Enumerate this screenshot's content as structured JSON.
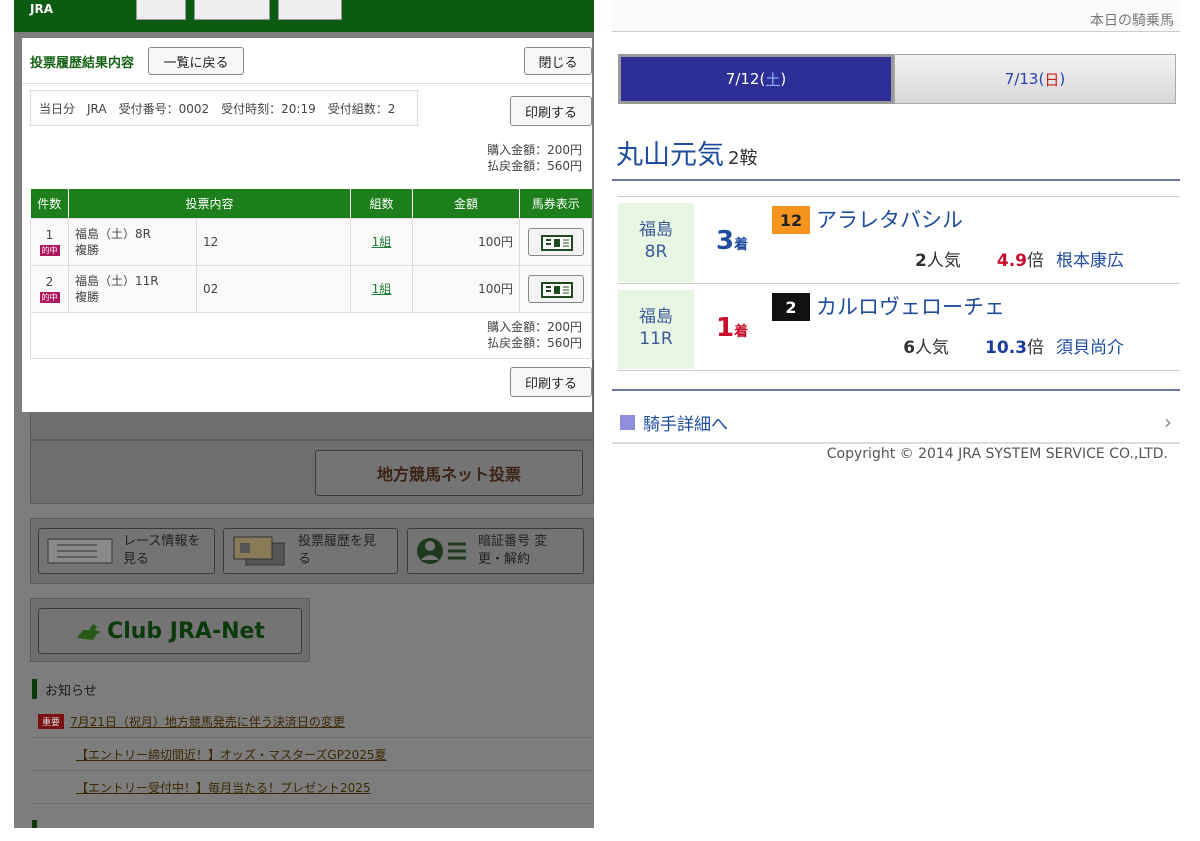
{
  "left": {
    "logo": "JRA",
    "net_button": "地方競馬ネット投票",
    "menu": [
      {
        "label": "レース情報を見る"
      },
      {
        "label": "投票履歴を見る"
      },
      {
        "label": "暗証番号 変更・解約"
      }
    ],
    "club": "Club JRA-Net",
    "notice_heading": "お知らせ",
    "notices": [
      {
        "badge": "重要",
        "text": "7月21日（祝月）地方競馬発売に伴う決済日の変更"
      },
      {
        "badge": "",
        "text": "【エントリー締切間近！】オッズ・マスターズGP2025夏"
      },
      {
        "badge": "",
        "text": "【エントリー受付中！】毎月当たる！プレゼント2025"
      }
    ],
    "modal": {
      "title": "投票履歴結果内容",
      "back_label": "一覧に戻る",
      "close_label": "閉じる",
      "info": "当日分　JRA　受付番号：0002　受付時刻：20:19　受付組数：2",
      "print_label": "印刷する",
      "purchase": "購入金額：200円",
      "refund": "払戻金額：560円",
      "headers": [
        "件数",
        "投票内容",
        "組数",
        "金額",
        "馬券表示"
      ],
      "rows": [
        {
          "num": "1",
          "hit": "的中",
          "race": "福島（土）8R",
          "type": "複勝",
          "content": "12",
          "kumi": "1組",
          "amount": "100円"
        },
        {
          "num": "2",
          "hit": "的中",
          "race": "福島（土）11R",
          "type": "複勝",
          "content": "02",
          "kumi": "1組",
          "amount": "100円"
        }
      ]
    }
  },
  "right": {
    "top_text": "本日の騎乗馬",
    "tabs": [
      {
        "date": "7/12",
        "dow": "土",
        "active": true
      },
      {
        "date": "7/13",
        "dow": "日",
        "active": false
      }
    ],
    "jockey": "丸山元気",
    "rides": "2鞍",
    "results": [
      {
        "venue": "福島",
        "race": "8R",
        "place": "3",
        "place_suffix": "着",
        "place_color": "#1f4d9e",
        "horse_num": "12",
        "num_bg": "#f5951f",
        "num_fg": "#222222",
        "horse": "アラレタバシル",
        "pop": "2",
        "pop_suffix": "人気",
        "odds": "4.9",
        "odds_suffix": "倍",
        "odds_color": "red",
        "trainer": "根本康広"
      },
      {
        "venue": "福島",
        "race": "11R",
        "place": "1",
        "place_suffix": "着",
        "place_color": "#c8102e",
        "horse_num": "2",
        "num_bg": "#111111",
        "num_fg": "#ffffff",
        "horse": "カルロヴェローチェ",
        "pop": "6",
        "pop_suffix": "人気",
        "odds": "10.3",
        "odds_suffix": "倍",
        "odds_color": "blue",
        "trainer": "須貝尚介"
      }
    ],
    "jockey_link": "騎手詳細へ",
    "copyright": "Copyright © 2014 JRA SYSTEM SERVICE CO.,LTD."
  }
}
